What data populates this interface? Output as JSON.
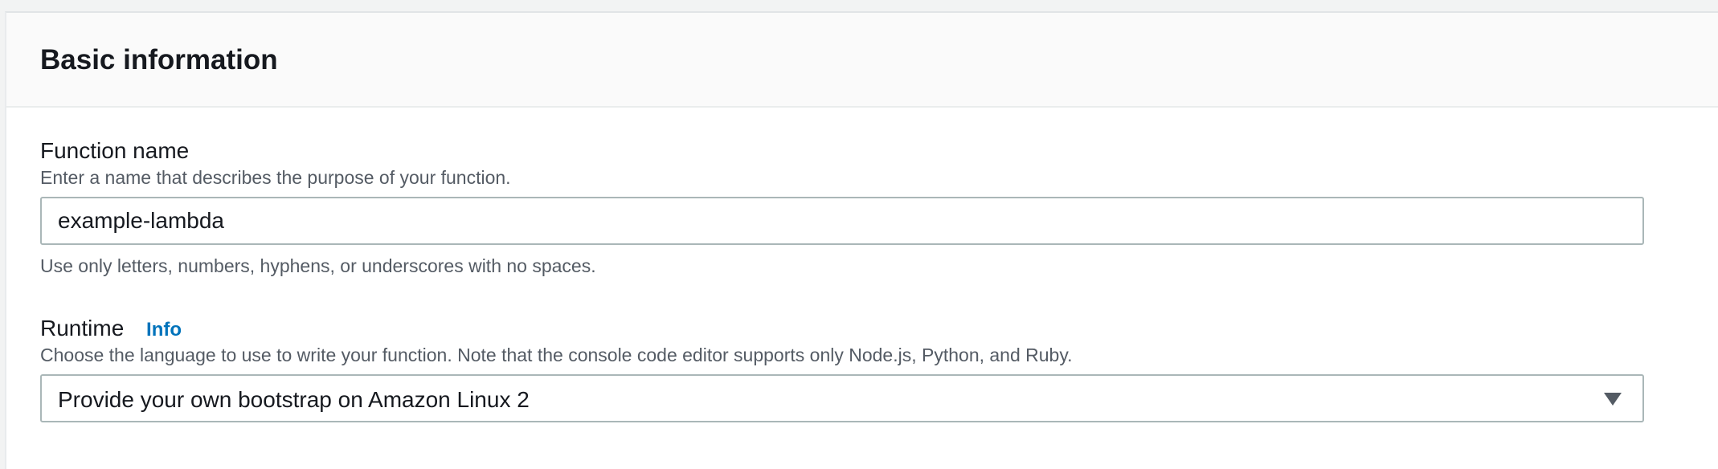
{
  "panel": {
    "title": "Basic information"
  },
  "function_name": {
    "label": "Function name",
    "description": "Enter a name that describes the purpose of your function.",
    "value": "example-lambda",
    "constraint": "Use only letters, numbers, hyphens, or underscores with no spaces."
  },
  "runtime": {
    "label": "Runtime",
    "info_link": "Info",
    "description": "Choose the language to use to write your function. Note that the console code editor supports only Node.js, Python, and Ruby.",
    "selected": "Provide your own bootstrap on Amazon Linux 2",
    "icon": "chevron-down-icon"
  },
  "colors": {
    "link": "#0073bb",
    "text": "#16191f",
    "muted": "#545b64",
    "border": "#aab7b8"
  }
}
